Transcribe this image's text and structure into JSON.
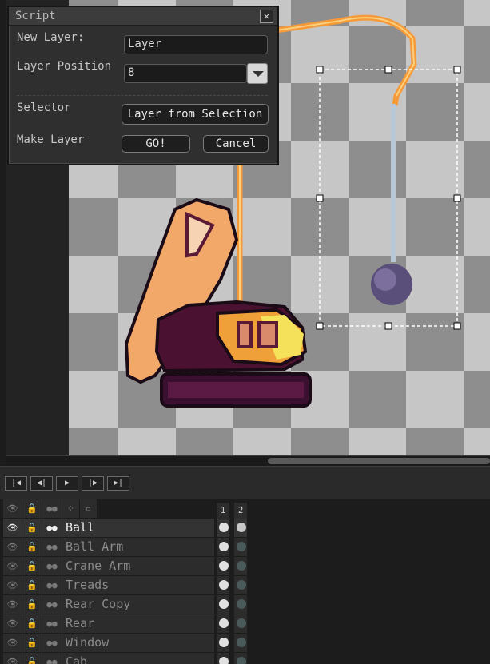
{
  "dialog": {
    "title": "Script",
    "close_glyph": "✕",
    "new_layer_label": "New Layer:",
    "new_layer_value": "Layer",
    "layer_position_label": "Layer Position",
    "layer_position_value": "8",
    "selector_label": "Selector",
    "selector_button": "Layer from Selection",
    "make_layer_label": "Make Layer",
    "go_button": "GO!",
    "cancel_button": "Cancel"
  },
  "timeline": {
    "controls": [
      {
        "name": "first-frame-button",
        "glyph": "|◀"
      },
      {
        "name": "previous-frame-button",
        "glyph": "◀|"
      },
      {
        "name": "play-button",
        "glyph": "▶"
      },
      {
        "name": "next-frame-button",
        "glyph": "|▶"
      },
      {
        "name": "last-frame-button",
        "glyph": "▶|"
      }
    ],
    "frames": [
      "1",
      "2"
    ]
  },
  "layers": [
    {
      "name": "Ball",
      "active": true
    },
    {
      "name": "Ball Arm",
      "active": false
    },
    {
      "name": "Crane Arm",
      "active": false
    },
    {
      "name": "Treads",
      "active": false
    },
    {
      "name": "Rear Copy",
      "active": false
    },
    {
      "name": "Rear",
      "active": false
    },
    {
      "name": "Window",
      "active": false
    },
    {
      "name": "Cab",
      "active": false
    }
  ],
  "colors": {
    "accent_orange": "#f7a14a",
    "selection": "#ffffff",
    "panel_bg": "#2f2f2f"
  },
  "icons": [
    "eye-icon",
    "lock-icon",
    "link-icon",
    "tilemap-icon",
    "reference-icon",
    "close-icon",
    "dropdown-arrow-icon"
  ]
}
